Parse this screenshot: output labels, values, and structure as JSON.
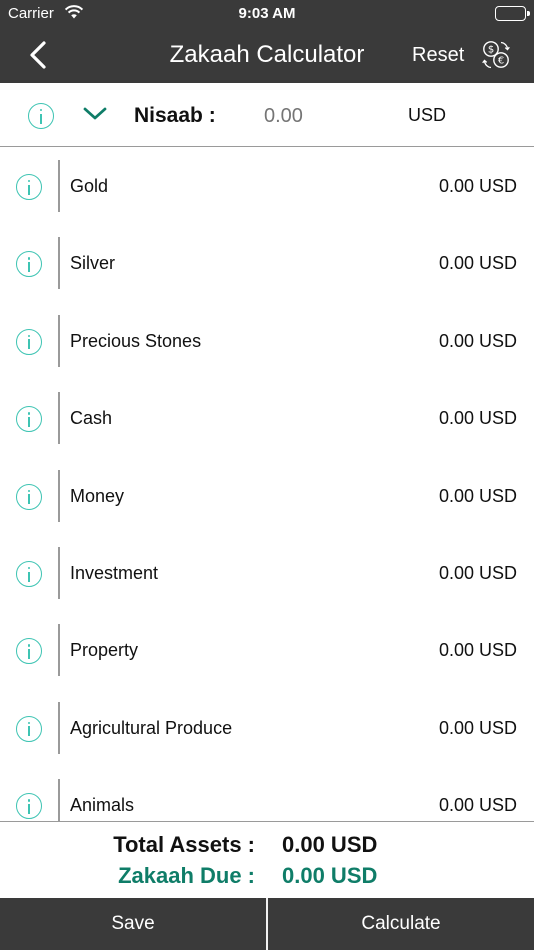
{
  "status_bar": {
    "carrier": "Carrier",
    "time": "9:03 AM"
  },
  "nav": {
    "title": "Zakaah Calculator",
    "reset_label": "Reset",
    "back_icon": "chevron-left-icon",
    "currency_icon": "currency-exchange-icon"
  },
  "nisaab": {
    "label": "Nisaab :",
    "value": "",
    "placeholder": "0.00",
    "currency": "USD"
  },
  "assets": [
    {
      "name": "Gold",
      "amount": "0.00 USD"
    },
    {
      "name": "Silver",
      "amount": "0.00 USD"
    },
    {
      "name": "Precious Stones",
      "amount": "0.00 USD"
    },
    {
      "name": "Cash",
      "amount": "0.00 USD"
    },
    {
      "name": "Money",
      "amount": "0.00 USD"
    },
    {
      "name": "Investment",
      "amount": "0.00 USD"
    },
    {
      "name": "Property",
      "amount": "0.00 USD"
    },
    {
      "name": "Agricultural Produce",
      "amount": "0.00 USD"
    },
    {
      "name": "Animals",
      "amount": "0.00 USD"
    }
  ],
  "totals": {
    "total_assets_label": "Total Assets :",
    "total_assets_value": "0.00 USD",
    "zakaah_due_label": "Zakaah Due :",
    "zakaah_due_value": "0.00 USD"
  },
  "actions": {
    "save_label": "Save",
    "calculate_label": "Calculate"
  },
  "colors": {
    "header": "#3a3a3a",
    "accent": "#3ec4b3",
    "zakaah_due": "#0f7d68"
  }
}
